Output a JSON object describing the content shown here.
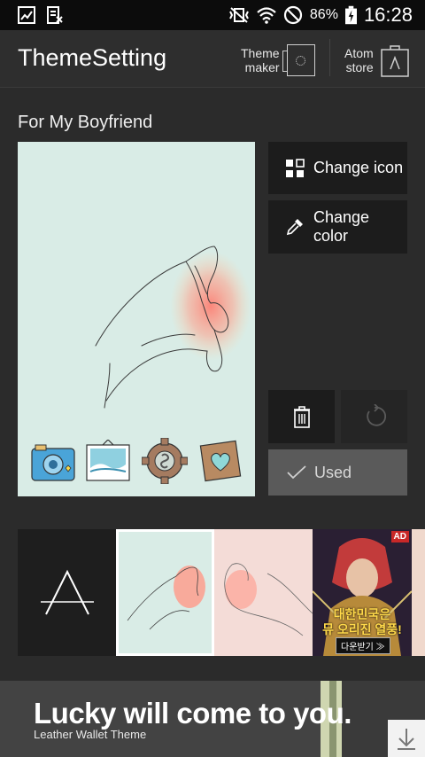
{
  "status_bar": {
    "battery": "86%",
    "time": "16:28"
  },
  "app_bar": {
    "title": "ThemeSetting",
    "theme_maker": [
      "Theme",
      "maker"
    ],
    "atom_store": [
      "Atom",
      "store"
    ]
  },
  "theme": {
    "name": "For My Boyfriend"
  },
  "actions": {
    "change_icon": "Change icon",
    "change_color": [
      "Change",
      "color"
    ],
    "used": "Used"
  },
  "ad_thumb": {
    "badge": "AD",
    "line1": "대한민국은",
    "line2": "뮤 오리진 열풍!",
    "cta": "다운받기 ≫"
  },
  "banner": {
    "title": "Lucky will come to you.",
    "subtitle": "Leather Wallet Theme"
  },
  "colors": {
    "background": "#2b2b2b",
    "button_bg": "#1c1c1c",
    "preview_bg": "#d9ece6",
    "heart_glow": "#ff8a7a"
  }
}
